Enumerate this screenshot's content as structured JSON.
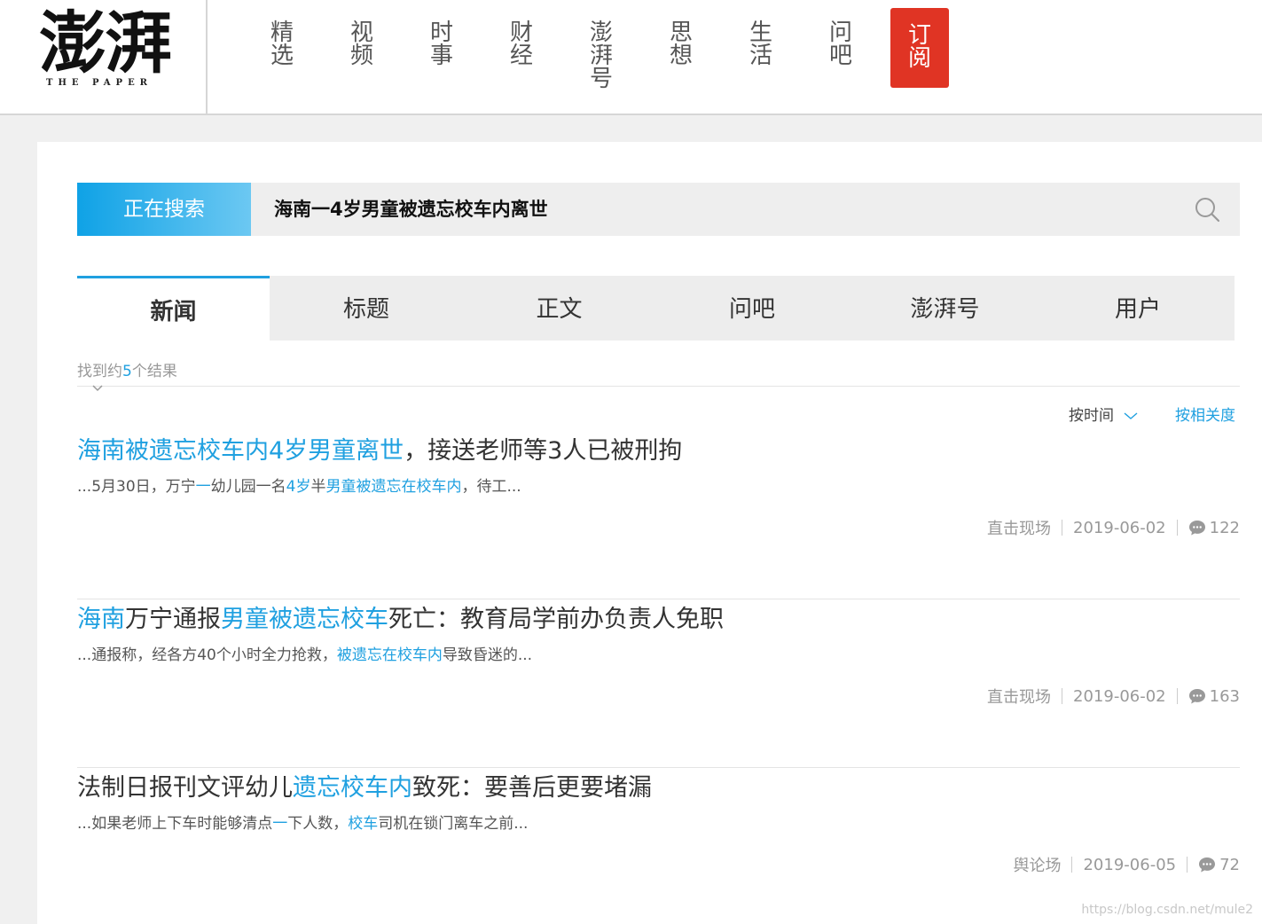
{
  "header": {
    "logo_text": "澎湃",
    "logo_sub": "THE PAPER",
    "nav": [
      {
        "id": "featured",
        "lines": [
          "精",
          "选"
        ]
      },
      {
        "id": "video",
        "lines": [
          "视",
          "频"
        ]
      },
      {
        "id": "current",
        "lines": [
          "时",
          "事"
        ]
      },
      {
        "id": "finance",
        "lines": [
          "财",
          "经"
        ]
      },
      {
        "id": "pengpai-hao",
        "lines": [
          "澎",
          "湃",
          "号"
        ]
      },
      {
        "id": "thought",
        "lines": [
          "思",
          "想"
        ]
      },
      {
        "id": "life",
        "lines": [
          "生",
          "活"
        ]
      },
      {
        "id": "wenba",
        "lines": [
          "问",
          "吧"
        ]
      }
    ],
    "subscribe": [
      "订",
      "阅"
    ],
    "subscribe_color": "#e03424"
  },
  "search": {
    "label": "正在搜索",
    "query": "海南一4岁男童被遗忘校车内离世",
    "icon": "search-icon"
  },
  "tabs": [
    "新闻",
    "标题",
    "正文",
    "问吧",
    "澎湃号",
    "用户"
  ],
  "active_tab": "新闻",
  "results": {
    "prefix": "找到约",
    "count": "5",
    "suffix": "个结果",
    "sort_time": "按时间",
    "sort_relevance": "按相关度"
  },
  "items": [
    {
      "title_parts": [
        {
          "text": "海南被遗忘校车内4岁男童离世",
          "hl": true
        },
        {
          "text": "，接送老师等3人已被刑拘",
          "hl": false
        }
      ],
      "desc_parts": [
        {
          "text": "...5月30日，万宁",
          "hl": false
        },
        {
          "text": "一",
          "hl": true
        },
        {
          "text": "幼儿园一名",
          "hl": false
        },
        {
          "text": "4岁",
          "hl": true
        },
        {
          "text": "半",
          "hl": false
        },
        {
          "text": "男童被遗忘在校车内",
          "hl": true
        },
        {
          "text": "，待工...",
          "hl": false
        }
      ],
      "source": "直击现场",
      "date": "2019-06-02",
      "comments": "122"
    },
    {
      "title_parts": [
        {
          "text": "海南",
          "hl": true
        },
        {
          "text": "万宁通报",
          "hl": false
        },
        {
          "text": "男童被遗忘校车",
          "hl": true
        },
        {
          "text": "死亡：教育局学前办负责人免职",
          "hl": false
        }
      ],
      "desc_parts": [
        {
          "text": "...通报称，经各方40个小时全力抢救，",
          "hl": false
        },
        {
          "text": "被遗忘在校车内",
          "hl": true
        },
        {
          "text": "导致昏迷的...",
          "hl": false
        }
      ],
      "source": "直击现场",
      "date": "2019-06-02",
      "comments": "163"
    },
    {
      "title_parts": [
        {
          "text": "法制日报刊文评幼儿",
          "hl": false
        },
        {
          "text": "遗忘校车内",
          "hl": true
        },
        {
          "text": "致死：要善后更要堵漏",
          "hl": false
        }
      ],
      "desc_parts": [
        {
          "text": "...如果老师上下车时能够清点",
          "hl": false
        },
        {
          "text": "一",
          "hl": true
        },
        {
          "text": "下人数，",
          "hl": false
        },
        {
          "text": "校车",
          "hl": true
        },
        {
          "text": "司机在锁门离车之前...",
          "hl": false
        }
      ],
      "source": "舆论场",
      "date": "2019-06-05",
      "comments": "72"
    }
  ],
  "watermark": "https://blog.csdn.net/mule2",
  "colors": {
    "accent": "#1fa0e0",
    "brand_red": "#e03424"
  }
}
